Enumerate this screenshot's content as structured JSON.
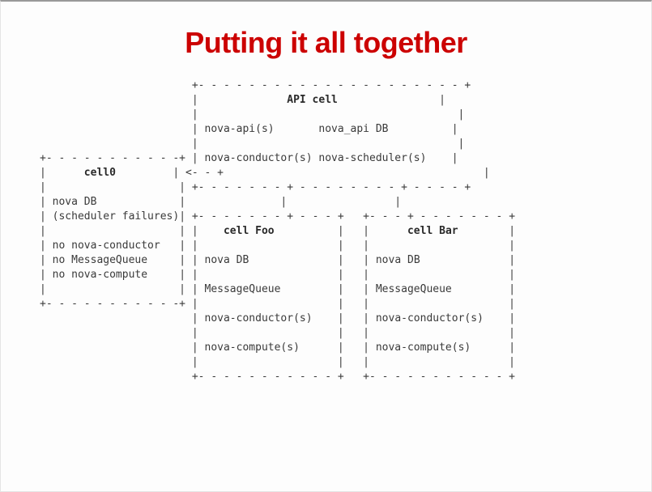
{
  "title": "Putting it all together",
  "api_cell": {
    "heading": "API cell",
    "row1_left": "nova-api(s)",
    "row1_right": "nova_api DB",
    "row2_left": "nova-conductor(s)",
    "row2_right": "nova-scheduler(s)"
  },
  "cell0": {
    "heading": "cell0",
    "line1": "nova DB",
    "line2": "(scheduler failures)",
    "line3": "no nova-conductor",
    "line4": "no MessageQueue",
    "line5": "no nova-compute"
  },
  "cell_foo": {
    "heading": "cell Foo",
    "line1": "nova DB",
    "line2": "MessageQueue",
    "line3": "nova-conductor(s)",
    "line4": "nova-compute(s)"
  },
  "cell_bar": {
    "heading": "cell Bar",
    "line1": "nova DB",
    "line2": "MessageQueue",
    "line3": "nova-conductor(s)",
    "line4": "nova-compute(s)"
  }
}
